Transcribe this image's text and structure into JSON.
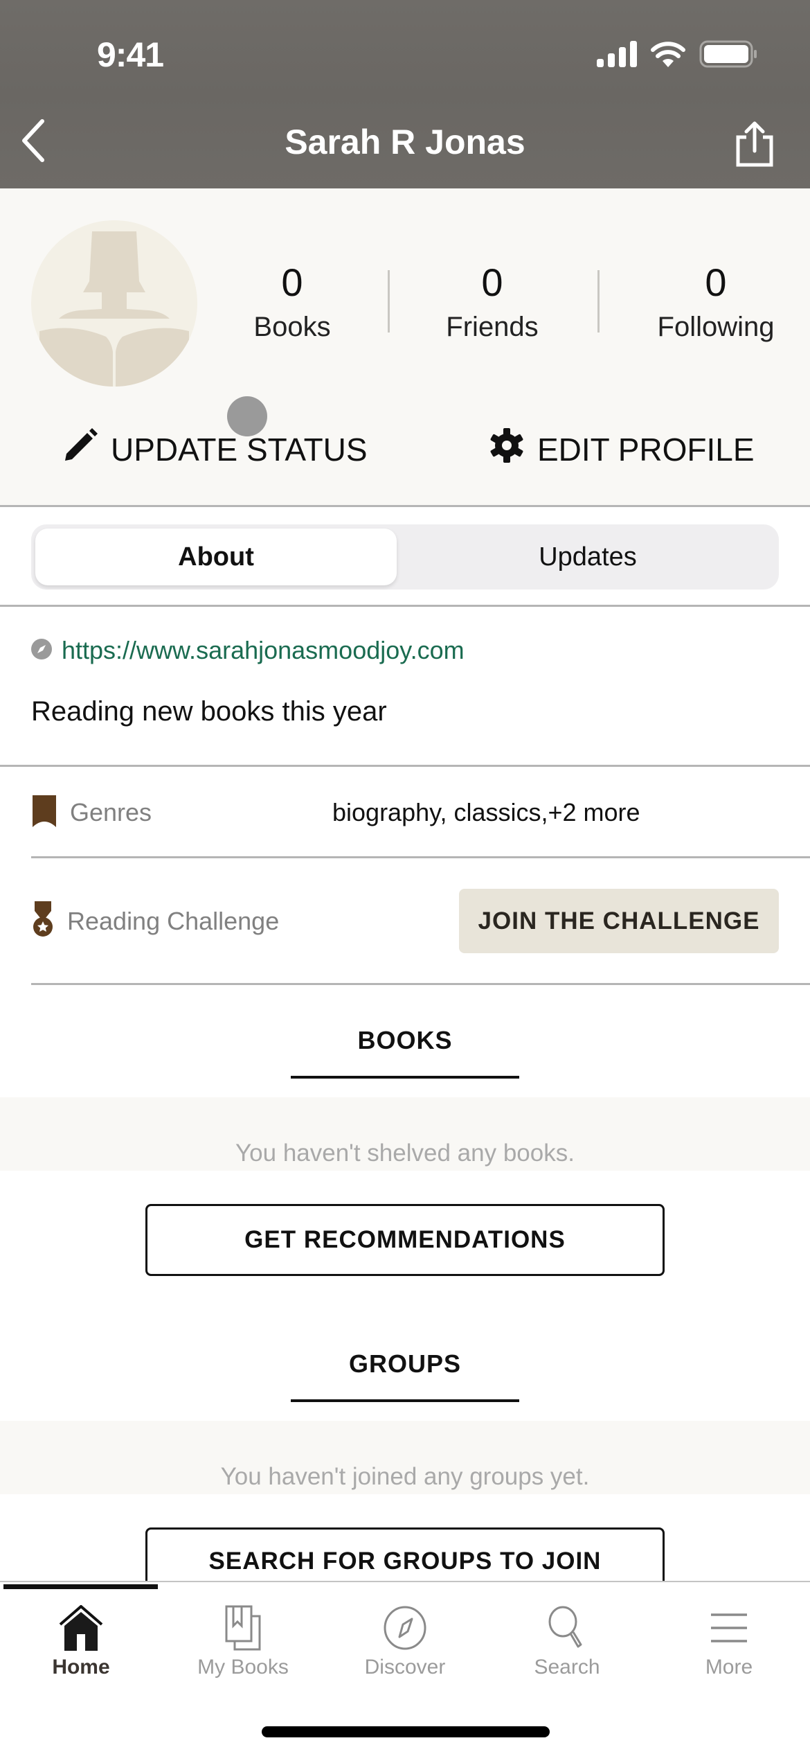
{
  "status_bar": {
    "time": "9:41",
    "icons": [
      "cellular-signal-icon",
      "wifi-icon",
      "battery-icon"
    ]
  },
  "nav": {
    "title": "Sarah R Jonas",
    "back_icon": "chevron-left-icon",
    "share_icon": "share-icon"
  },
  "profile": {
    "avatar_icon": "reader-silhouette-icon",
    "stats": [
      {
        "value": "0",
        "label": "Books"
      },
      {
        "value": "0",
        "label": "Friends"
      },
      {
        "value": "0",
        "label": "Following"
      }
    ],
    "actions": {
      "update_status": "UPDATE STATUS",
      "edit_profile": "EDIT PROFILE"
    }
  },
  "segmented": {
    "tabs": [
      {
        "label": "About",
        "selected": true
      },
      {
        "label": "Updates",
        "selected": false
      }
    ]
  },
  "about": {
    "website": "https://www.sarahjonasmoodjoy.com",
    "bio": "Reading new books this year",
    "genres_label": "Genres",
    "genres_value": "biography, classics,+2 more",
    "challenge_label": "Reading Challenge",
    "challenge_button": "JOIN THE CHALLENGE"
  },
  "books_section": {
    "title": "BOOKS",
    "empty_text": "You haven't shelved any books.",
    "button": "GET RECOMMENDATIONS"
  },
  "groups_section": {
    "title": "GROUPS",
    "empty_text": "You haven't joined any groups yet.",
    "button": "SEARCH FOR GROUPS TO JOIN"
  },
  "tabbar": {
    "items": [
      {
        "label": "Home",
        "icon": "home-icon",
        "active": true
      },
      {
        "label": "My Books",
        "icon": "my-books-icon",
        "active": false
      },
      {
        "label": "Discover",
        "icon": "compass-icon",
        "active": false
      },
      {
        "label": "Search",
        "icon": "search-icon",
        "active": false
      },
      {
        "label": "More",
        "icon": "menu-icon",
        "active": false
      }
    ]
  },
  "colors": {
    "header_bg": "#6e6b67",
    "profile_bg": "#f9f8f5",
    "link": "#1a6b50",
    "brown_accent": "#5e3d1e",
    "challenge_button_bg": "#e8e4d9",
    "muted_text": "#a9a9a9"
  }
}
